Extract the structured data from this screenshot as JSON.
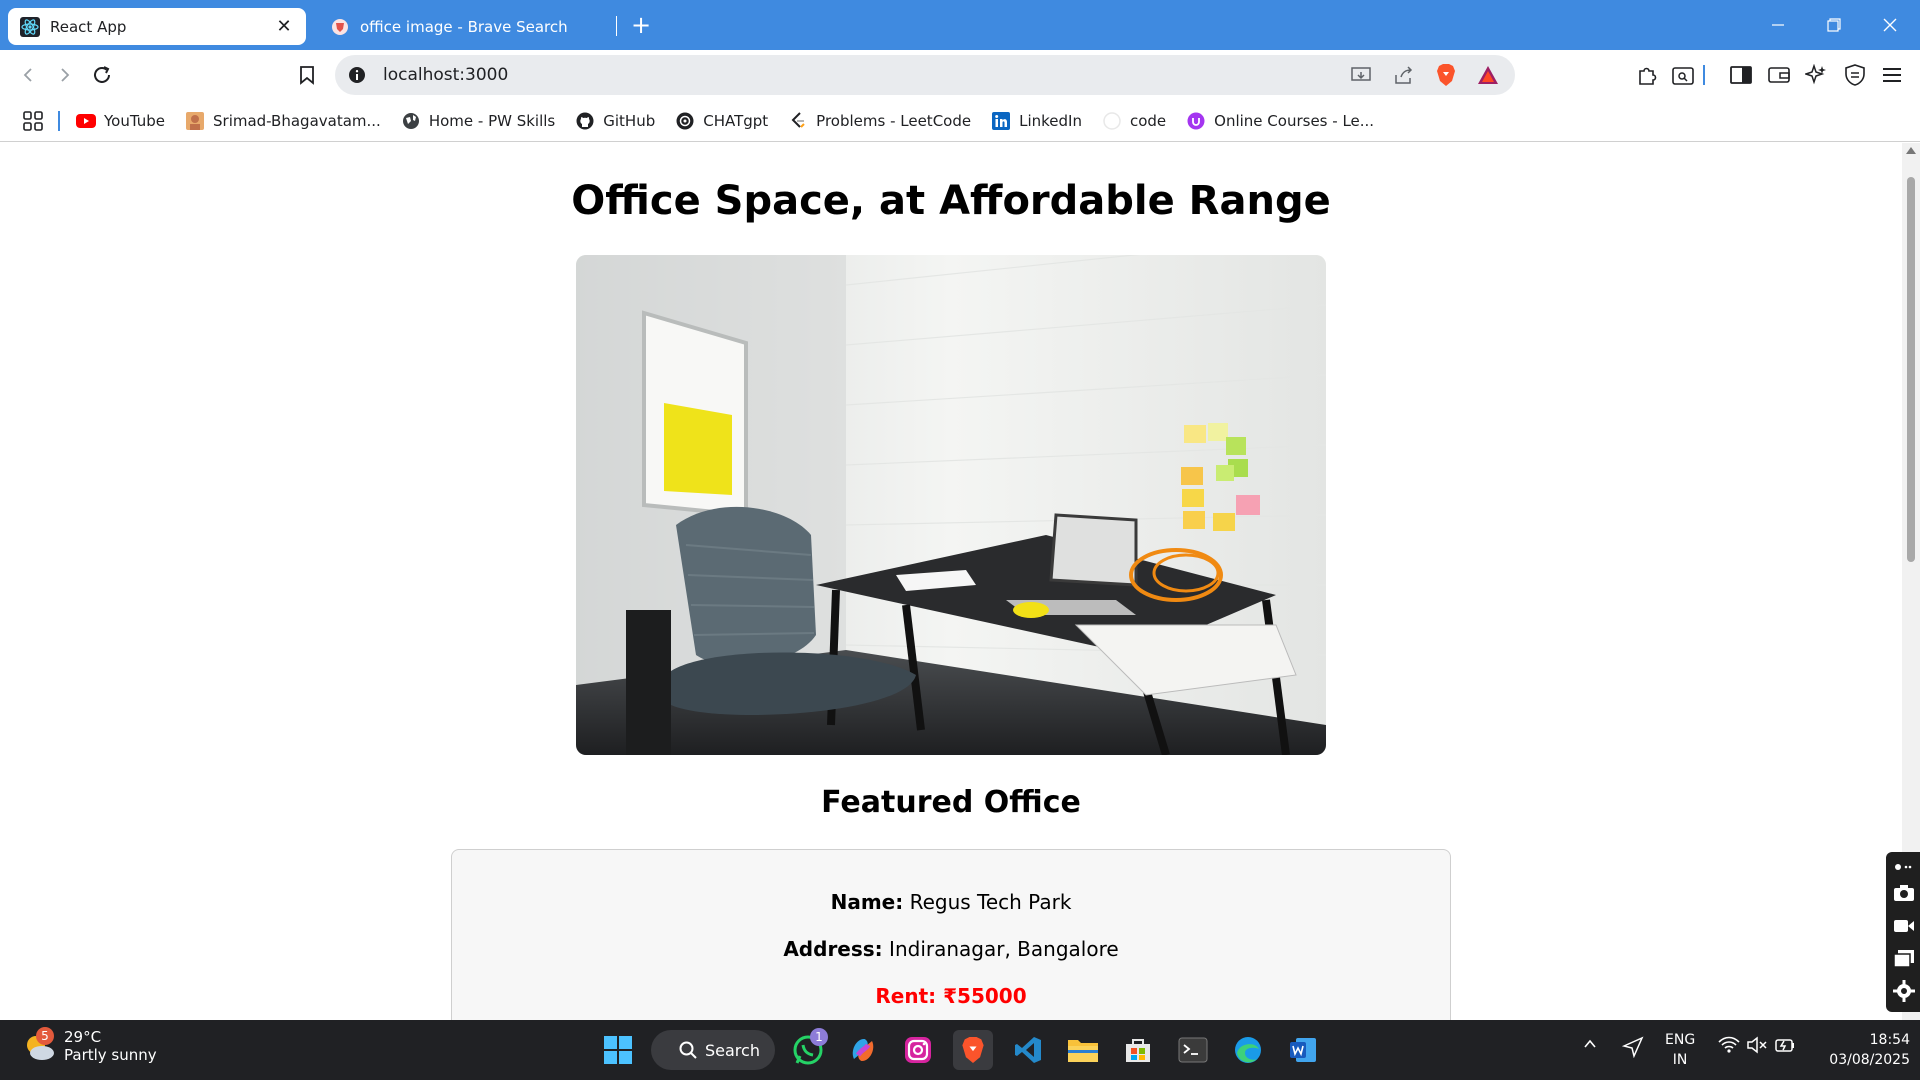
{
  "browser": {
    "tabs": [
      {
        "title": "React App",
        "active": true
      },
      {
        "title": "office image - Brave Search",
        "active": false
      }
    ],
    "url": "localhost:3000",
    "bookmarks": [
      {
        "label": "YouTube",
        "icon": "youtube-icon"
      },
      {
        "label": "Srimad-Bhagavatam...",
        "icon": "avatar-icon"
      },
      {
        "label": "Home - PW Skills",
        "icon": "globe-icon"
      },
      {
        "label": "GitHub",
        "icon": "github-icon"
      },
      {
        "label": "CHATgpt",
        "icon": "openai-icon"
      },
      {
        "label": "Problems - LeetCode",
        "icon": "leetcode-icon"
      },
      {
        "label": "LinkedIn",
        "icon": "linkedin-icon"
      },
      {
        "label": "code",
        "icon": "code-icon"
      },
      {
        "label": "Online Courses - Le...",
        "icon": "udemy-icon"
      }
    ],
    "accent_color": "#3f8ae0"
  },
  "page": {
    "title": "Office Space, at Affordable Range",
    "section_title": "Featured Office",
    "office": {
      "name_label": "Name:",
      "name": "Regus Tech Park",
      "address_label": "Address:",
      "address": "Indiranagar, Bangalore",
      "rent_label": "Rent:",
      "rent": "₹55000",
      "rent_color": "#ff0000"
    }
  },
  "taskbar": {
    "weather": {
      "badge": "5",
      "temp": "29°C",
      "condition": "Partly sunny"
    },
    "search_label": "Search",
    "whatsapp_badge": "1",
    "language": {
      "line1": "ENG",
      "line2": "IN"
    },
    "time": "18:54",
    "date": "03/08/2025"
  }
}
